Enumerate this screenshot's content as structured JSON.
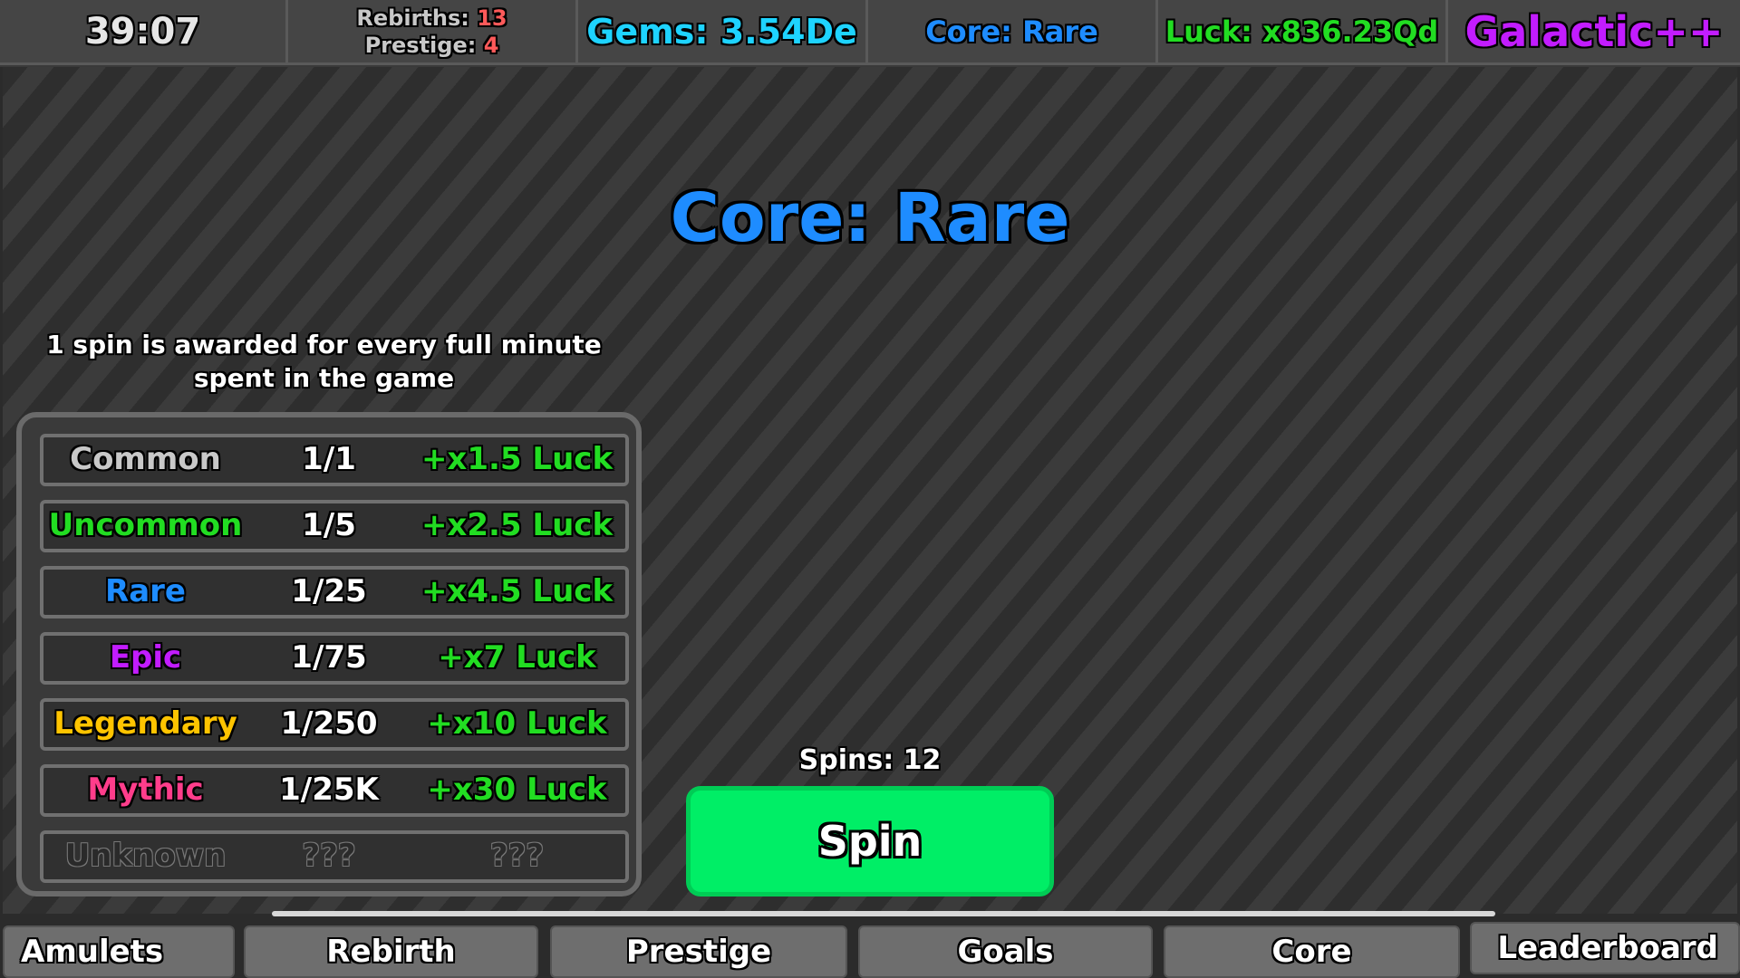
{
  "header": {
    "timer": "39:07",
    "rebirths_label": "Rebirths: ",
    "rebirths_value": "13",
    "prestige_label": "Prestige: ",
    "prestige_value": "4",
    "gems": "Gems: 3.54De",
    "core": "Core: Rare",
    "luck": "Luck: x836.23Qd",
    "rank": "Galactic++"
  },
  "main": {
    "core_title": "Core: Rare",
    "info_text": "1 spin is awarded for every full minute spent in the game",
    "spins_label": "Spins: 12",
    "spin_button": "Spin"
  },
  "rarities": [
    {
      "name": "Common",
      "chance": "1/1",
      "bonus": "+x1.5 Luck",
      "color": "#c8c8c8"
    },
    {
      "name": "Uncommon",
      "chance": "1/5",
      "bonus": "+x2.5 Luck",
      "color": "#22dd22"
    },
    {
      "name": "Rare",
      "chance": "1/25",
      "bonus": "+x4.5 Luck",
      "color": "#1e8cff"
    },
    {
      "name": "Epic",
      "chance": "1/75",
      "bonus": "+x7 Luck",
      "color": "#c21cff"
    },
    {
      "name": "Legendary",
      "chance": "1/250",
      "bonus": "+x10 Luck",
      "color": "#ffc400"
    },
    {
      "name": "Mythic",
      "chance": "1/25K",
      "bonus": "+x30 Luck",
      "color": "#ff3d8b"
    },
    {
      "name": "Unknown",
      "chance": "???",
      "bonus": "???",
      "color": "#2a2a2a"
    }
  ],
  "nav": {
    "tabs": [
      "Amulets",
      "Rebirth",
      "Prestige",
      "Goals",
      "Core",
      "Leaderboard"
    ]
  }
}
